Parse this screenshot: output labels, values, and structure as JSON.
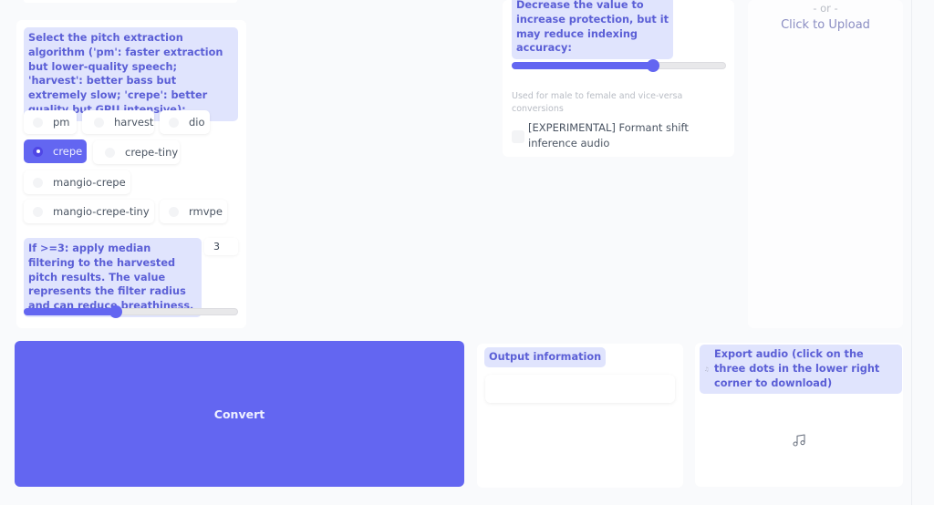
{
  "pitch_algorithm": {
    "label": "Select the pitch extraction algorithm ('pm': faster extraction but lower-quality speech; 'harvest': better bass but extremely slow; 'crepe': better quality but GPU intensive):",
    "options": [
      "pm",
      "harvest",
      "dio",
      "crepe",
      "crepe-tiny",
      "mangio-crepe",
      "mangio-crepe-tiny",
      "rmvpe"
    ],
    "selected": "crepe"
  },
  "median_filter": {
    "label": "If >=3: apply median filtering to the harvested pitch results. The value represents the filter radius and can reduce breathiness.",
    "value": "3",
    "slider_fraction": 0.43
  },
  "protect": {
    "label": "Decrease the value to increase protection, but it may reduce indexing accuracy:",
    "slider_fraction": 0.66
  },
  "formant": {
    "hint": "Used for male to female and vice-versa conversions",
    "checkbox_label": "[EXPERIMENTAL] Formant shift inference audio",
    "checked": false
  },
  "upload": {
    "or_text": "- or -",
    "click_text": "Click to Upload"
  },
  "convert": {
    "label": "Convert"
  },
  "output": {
    "label": "Output information",
    "value": ""
  },
  "export": {
    "label": "Export audio (click on the three dots in the lower right corner to download)",
    "icon": "music-icon"
  },
  "colors": {
    "accent": "#6366f1",
    "label_bg": "#e0e4fd",
    "label_text": "#5b5fd6",
    "background": "#f9fafc"
  }
}
